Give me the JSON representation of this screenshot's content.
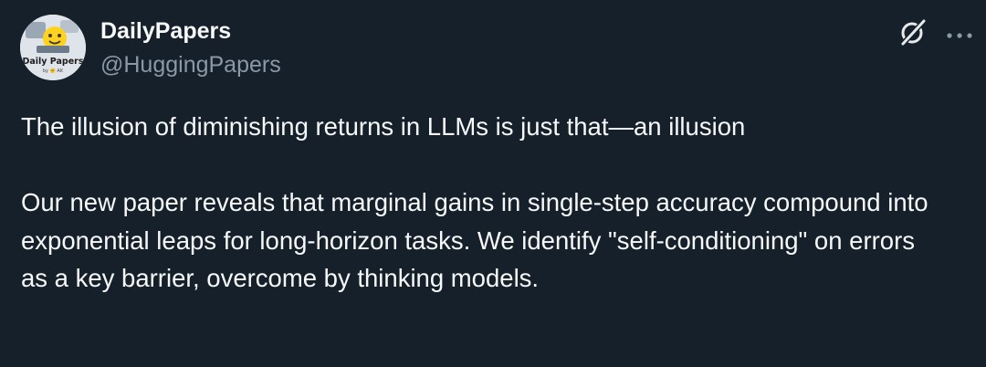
{
  "tweet": {
    "author": {
      "display_name": "DailyPapers",
      "handle": "@HuggingPapers",
      "avatar_text": "Daily Papers",
      "avatar_subtext": "by 🤗 AK"
    },
    "text": {
      "paragraph_1": "The illusion of diminishing returns in LLMs is just that—an illusion",
      "paragraph_2": "Our new paper reveals that marginal gains in single-step accuracy compound into exponential leaps for long-horizon tasks. We identify \"self-conditioning\" on errors as a key barrier, overcome by thinking models."
    },
    "icons": {
      "grok": "grok-icon",
      "more": "more-options-icon"
    }
  },
  "colors": {
    "background": "#15202b",
    "primary_text": "#f7f9f9",
    "secondary_text": "#8b98a5"
  }
}
